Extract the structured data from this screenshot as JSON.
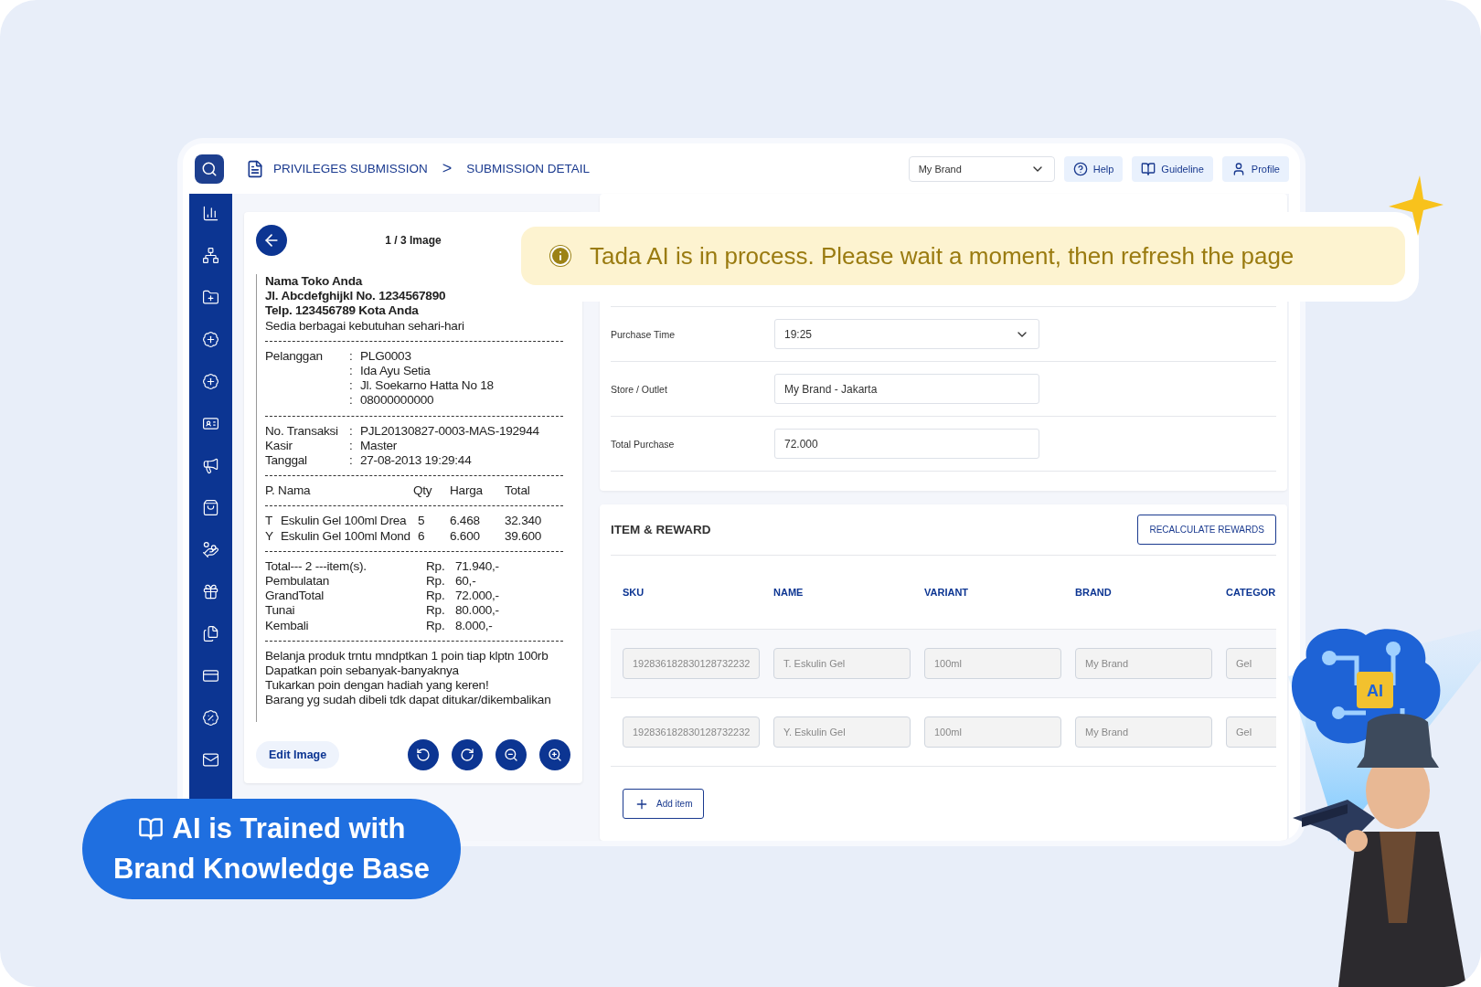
{
  "topbar": {
    "breadcrumbs": [
      {
        "label": "PRIVILEGES SUBMISSION"
      },
      {
        "label": "SUBMISSION DETAIL"
      }
    ],
    "separator": ">",
    "brand_select": "My Brand",
    "buttons": [
      {
        "kind": "help",
        "label": "Help"
      },
      {
        "kind": "guideline",
        "label": "Guideline"
      },
      {
        "kind": "profile",
        "label": "Profile"
      }
    ]
  },
  "receipt_viewer": {
    "page_label": "1 / 3 Image",
    "edit_button": "Edit Image",
    "lines": [
      {
        "kind": "text",
        "bold": true,
        "text": "Nama Toko Anda"
      },
      {
        "kind": "text",
        "bold": true,
        "text": "Jl. Abcdefghijkl No. 1234567890"
      },
      {
        "kind": "text",
        "bold": true,
        "text": "Telp. 123456789 Kota Anda"
      },
      {
        "kind": "text",
        "bold": false,
        "text": "Sedia berbagai kebutuhan sehari-hari"
      },
      {
        "kind": "divider"
      },
      {
        "kind": "field",
        "label": "Pelanggan",
        "sep": ":",
        "value": "PLG0003"
      },
      {
        "kind": "field",
        "sep": ":",
        "value": "Ida Ayu Setia"
      },
      {
        "kind": "field",
        "sep": ":",
        "value": "Jl. Soekarno Hatta No 18"
      },
      {
        "kind": "field",
        "sep": ":",
        "value": "08000000000"
      },
      {
        "kind": "divider"
      },
      {
        "kind": "field",
        "label": "No. Transaksi",
        "sep": ":",
        "value": "PJL20130827-0003-MAS-192944"
      },
      {
        "kind": "field",
        "label": "Kasir",
        "sep": ":",
        "value": "Master"
      },
      {
        "kind": "field",
        "label": "Tanggal",
        "sep": ":",
        "value": "27-08-2013  19:29:44"
      },
      {
        "kind": "divider"
      },
      {
        "kind": "head",
        "cells": [
          "P. Nama",
          "Qty",
          "Harga",
          "Total"
        ]
      },
      {
        "kind": "divider"
      },
      {
        "kind": "item",
        "cells": [
          "T",
          "Eskulin Gel 100ml Drea",
          "5",
          "6.468",
          "32.340"
        ]
      },
      {
        "kind": "item",
        "cells": [
          "Y",
          "Eskulin Gel 100ml Mond",
          "6",
          "6.600",
          "39.600"
        ]
      },
      {
        "kind": "divider"
      },
      {
        "kind": "total",
        "label": "Total--- 2 ---item(s).",
        "currency": "Rp.",
        "amount": "71.940,-"
      },
      {
        "kind": "total",
        "label": "Pembulatan",
        "currency": "Rp.",
        "amount": "60,-"
      },
      {
        "kind": "total",
        "label": "GrandTotal",
        "currency": "Rp.",
        "amount": "72.000,-"
      },
      {
        "kind": "total",
        "label": "Tunai",
        "currency": "Rp.",
        "amount": "80.000,-"
      },
      {
        "kind": "total",
        "label": "Kembali",
        "currency": "Rp.",
        "amount": "8.000,-"
      },
      {
        "kind": "divider"
      },
      {
        "kind": "text",
        "bold": false,
        "text": "Belanja produk trntu mndptkan 1 poin tiap klptn 100rb"
      },
      {
        "kind": "text",
        "bold": false,
        "text": "Dapatkan poin sebanyak-banyaknya"
      },
      {
        "kind": "text",
        "bold": false,
        "text": "Tukarkan poin dengan hadiah yang keren!"
      },
      {
        "kind": "text",
        "bold": false,
        "text": "Barang yg sudah dibeli tdk dapat ditukar/dikembalikan"
      }
    ]
  },
  "details_form": {
    "rows": [
      {
        "kind": "select",
        "label": "Purchase Time",
        "value": "19:25"
      },
      {
        "kind": "input",
        "label": "Store / Outlet",
        "value": "My Brand - Jakarta"
      },
      {
        "kind": "input",
        "label": "Total Purchase",
        "value": "72.000"
      }
    ]
  },
  "item_reward": {
    "title": "ITEM & REWARD",
    "recalculate_button": "RECALCULATE REWARDS",
    "columns": [
      "SKU",
      "NAME",
      "VARIANT",
      "BRAND",
      "CATEGOR"
    ],
    "rows": [
      [
        "192836182830128732232",
        "T. Eskulin Gel",
        "100ml",
        "My Brand",
        "Gel"
      ],
      [
        "192836182830128732232",
        "Y. Eskulin Gel",
        "100ml",
        "My Brand",
        "Gel"
      ]
    ],
    "add_button": "Add item"
  },
  "alert": {
    "message": "Tada AI is in process. Please wait a moment, then refresh the page"
  },
  "promo_badge": {
    "lines": [
      "AI is Trained with",
      "Brand Knowledge Base"
    ]
  },
  "mascot": {
    "chip_label": "AI"
  }
}
